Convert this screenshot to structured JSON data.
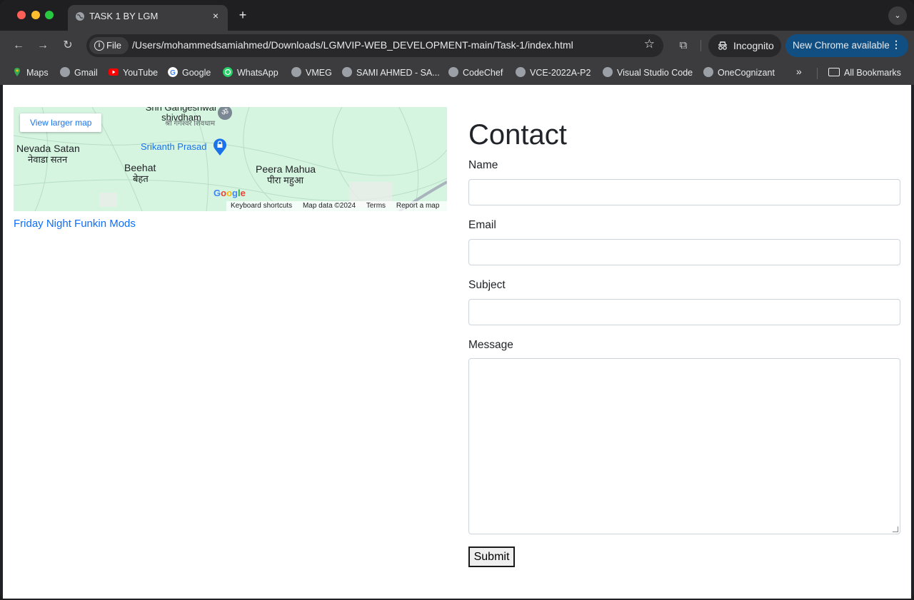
{
  "browser": {
    "tab": {
      "title": "TASK 1 BY LGM",
      "close": "×"
    },
    "new_tab": "+",
    "tab_search": "⌄",
    "nav": {
      "back": "←",
      "forward": "→",
      "reload": "↻"
    },
    "omnibox": {
      "chip_label": "File",
      "chip_icon": "i",
      "url": "/Users/mohammedsamiahmed/Downloads/LGMVIP-WEB_DEVELOPMENT-main/Task-1/index.html",
      "star": "☆"
    },
    "extensions_icon": "⧉",
    "incognito_label": "Incognito",
    "update_label": "New Chrome available",
    "update_menu": "⋮"
  },
  "bookmarks": {
    "items": [
      {
        "label": "Maps"
      },
      {
        "label": "Gmail"
      },
      {
        "label": "YouTube"
      },
      {
        "label": "Google"
      },
      {
        "label": "WhatsApp"
      },
      {
        "label": "VMEG"
      },
      {
        "label": "SAMI AHMED - SA..."
      },
      {
        "label": "CodeChef"
      },
      {
        "label": "VCE-2022A-P2"
      },
      {
        "label": "Visual Studio Code"
      },
      {
        "label": "OneCognizant"
      }
    ],
    "more": "»",
    "all_label": "All Bookmarks"
  },
  "map": {
    "view_larger": "View larger map",
    "places": {
      "shivdham": "Shri Gangeshwar shivdham",
      "shivdham_hi": "श्री गंगेश्वर शिवधाम",
      "nevada": "Nevada Satan",
      "nevada_hi": "नेवाडा सतन",
      "beehat": "Beehat",
      "beehat_hi": "बेहत",
      "srikanth": "Srikanth Prasad",
      "peera": "Peera Mahua",
      "peera_hi": "पीरा महुआ"
    },
    "google": "Google",
    "footer": {
      "shortcuts": "Keyboard shortcuts",
      "data": "Map data ©2024",
      "terms": "Terms",
      "report": "Report a map error"
    }
  },
  "link": "Friday Night Funkin Mods",
  "contact": {
    "title": "Contact",
    "name_label": "Name",
    "email_label": "Email",
    "subject_label": "Subject",
    "message_label": "Message",
    "submit": "Submit"
  },
  "colors": {
    "accent": "#0d6efd",
    "update_button": "#114e82",
    "map_bg": "#d5f5e1"
  }
}
